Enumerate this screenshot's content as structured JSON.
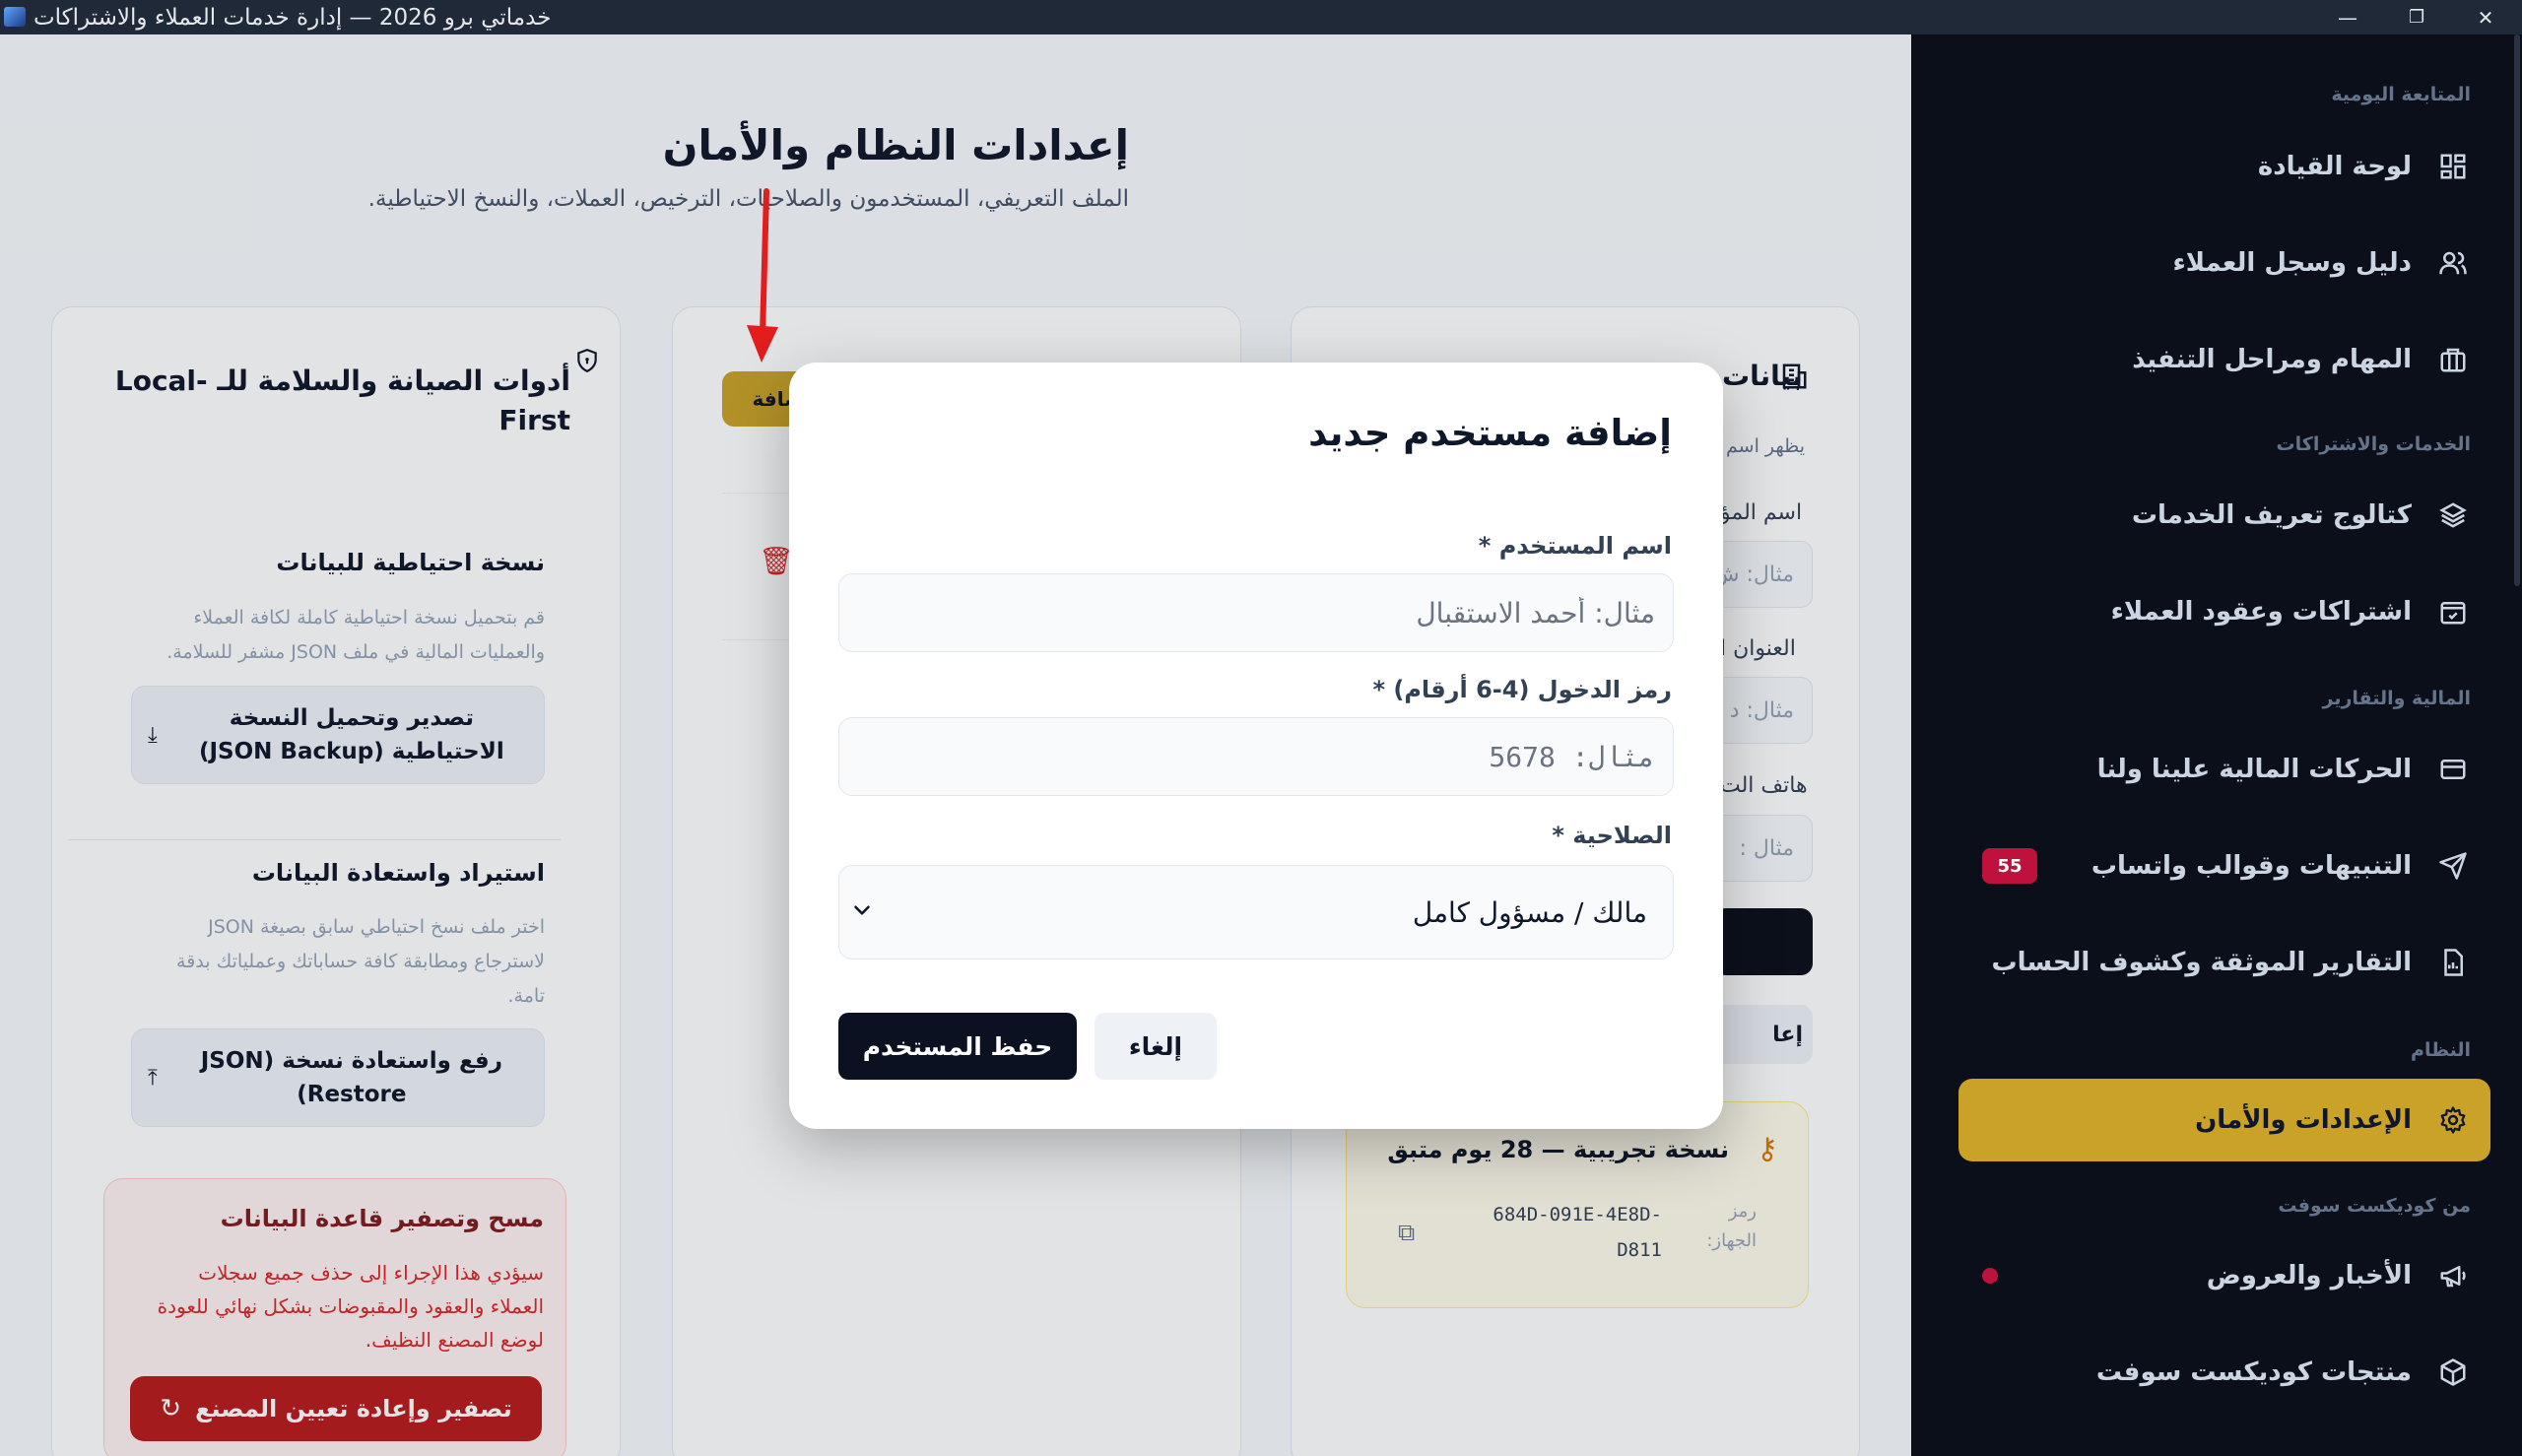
{
  "window": {
    "title": "خدماتي برو 2026 — إدارة خدمات العملاء والاشتراكات",
    "minimize": "—",
    "maximize": "❐",
    "close": "✕"
  },
  "header": {
    "title": "إعدادات النظام والأمان",
    "subtitle": "الملف التعريفي، المستخدمون والصلاحيات، الترخيص، العملات، والنسخ الاحتياطية."
  },
  "maintenance": {
    "title": "أدوات الصيانة والسلامة للـ Local-First",
    "backup_title": "نسخة احتياطية للبيانات",
    "backup_desc": "قم بتحميل نسخة احتياطية كاملة لكافة العملاء والعمليات المالية في ملف JSON مشفر للسلامة.",
    "backup_button": "تصدير وتحميل النسخة الاحتياطية (JSON Backup)",
    "restore_title": "استيراد واستعادة البيانات",
    "restore_desc": "اختر ملف نسخ احتياطي سابق بصيغة JSON لاسترجاع ومطابقة كافة حساباتك وعملياتك بدقة تامة.",
    "restore_button": "رفع واستعادة نسخة (JSON Restore)",
    "reset_title": "مسح وتصفير قاعدة البيانات",
    "reset_desc": "سيؤدي هذا الإجراء إلى حذف جميع سجلات العملاء والعقود والمقبوضات بشكل نهائي للعودة لوضع المصنع النظيف.",
    "reset_button": "تصفير وإعادة تعيين المصنع"
  },
  "users_card": {
    "add_button": "إضافة"
  },
  "company_card": {
    "title": "بيانات",
    "hint": "يظهر اسم",
    "name_label": "اسم المؤ",
    "name_placeholder": "مثال: ش",
    "address_label": "العنوان ا",
    "address_placeholder": "مثال: د",
    "phone_label": "هاتف الت",
    "phone_placeholder": "مثال :",
    "secondary_button": "إعا",
    "license_title": "نسخة تجريبية — 28 يوم متبق",
    "device_code_label": "رمز الجهاز:",
    "device_code": "684D-091E-4E8D-D811"
  },
  "sidebar": {
    "groups": [
      "المتابعة اليومية",
      "الخدمات والاشتراكات",
      "المالية والتقارير",
      "النظام",
      "من كوديكست سوفت"
    ],
    "items": [
      {
        "label": "لوحة القيادة",
        "icon": "dashboard-icon"
      },
      {
        "label": "دليل وسجل العملاء",
        "icon": "users-icon"
      },
      {
        "label": "المهام ومراحل التنفيذ",
        "icon": "briefcase-icon"
      },
      {
        "label": "كتالوج تعريف الخدمات",
        "icon": "layers-icon"
      },
      {
        "label": "اشتراكات وعقود العملاء",
        "icon": "calendar-check-icon"
      },
      {
        "label": "الحركات المالية علينا ولنا",
        "icon": "credit-card-icon"
      },
      {
        "label": "التنبيهات وقوالب واتساب",
        "icon": "send-icon",
        "badge": "55"
      },
      {
        "label": "التقارير الموثقة وكشوف الحساب",
        "icon": "file-report-icon"
      },
      {
        "label": "الإعدادات والأمان",
        "icon": "gear-icon",
        "active": true
      },
      {
        "label": "الأخبار والعروض",
        "icon": "megaphone-icon"
      },
      {
        "label": "منتجات كوديكست سوفت",
        "icon": "package-icon"
      }
    ],
    "accent_color": "#c9a227"
  },
  "modal": {
    "title": "إضافة مستخدم جديد",
    "username_label": "اسم المستخدم *",
    "username_placeholder": "مثال: أحمد الاستقبال",
    "pin_label": "رمز الدخول (4-6 أرقام) *",
    "pin_placeholder": "مثال: 5678",
    "role_label": "الصلاحية *",
    "role_value": "مالك / مسؤول كامل",
    "save_button": "حفظ المستخدم",
    "cancel_button": "إلغاء"
  }
}
